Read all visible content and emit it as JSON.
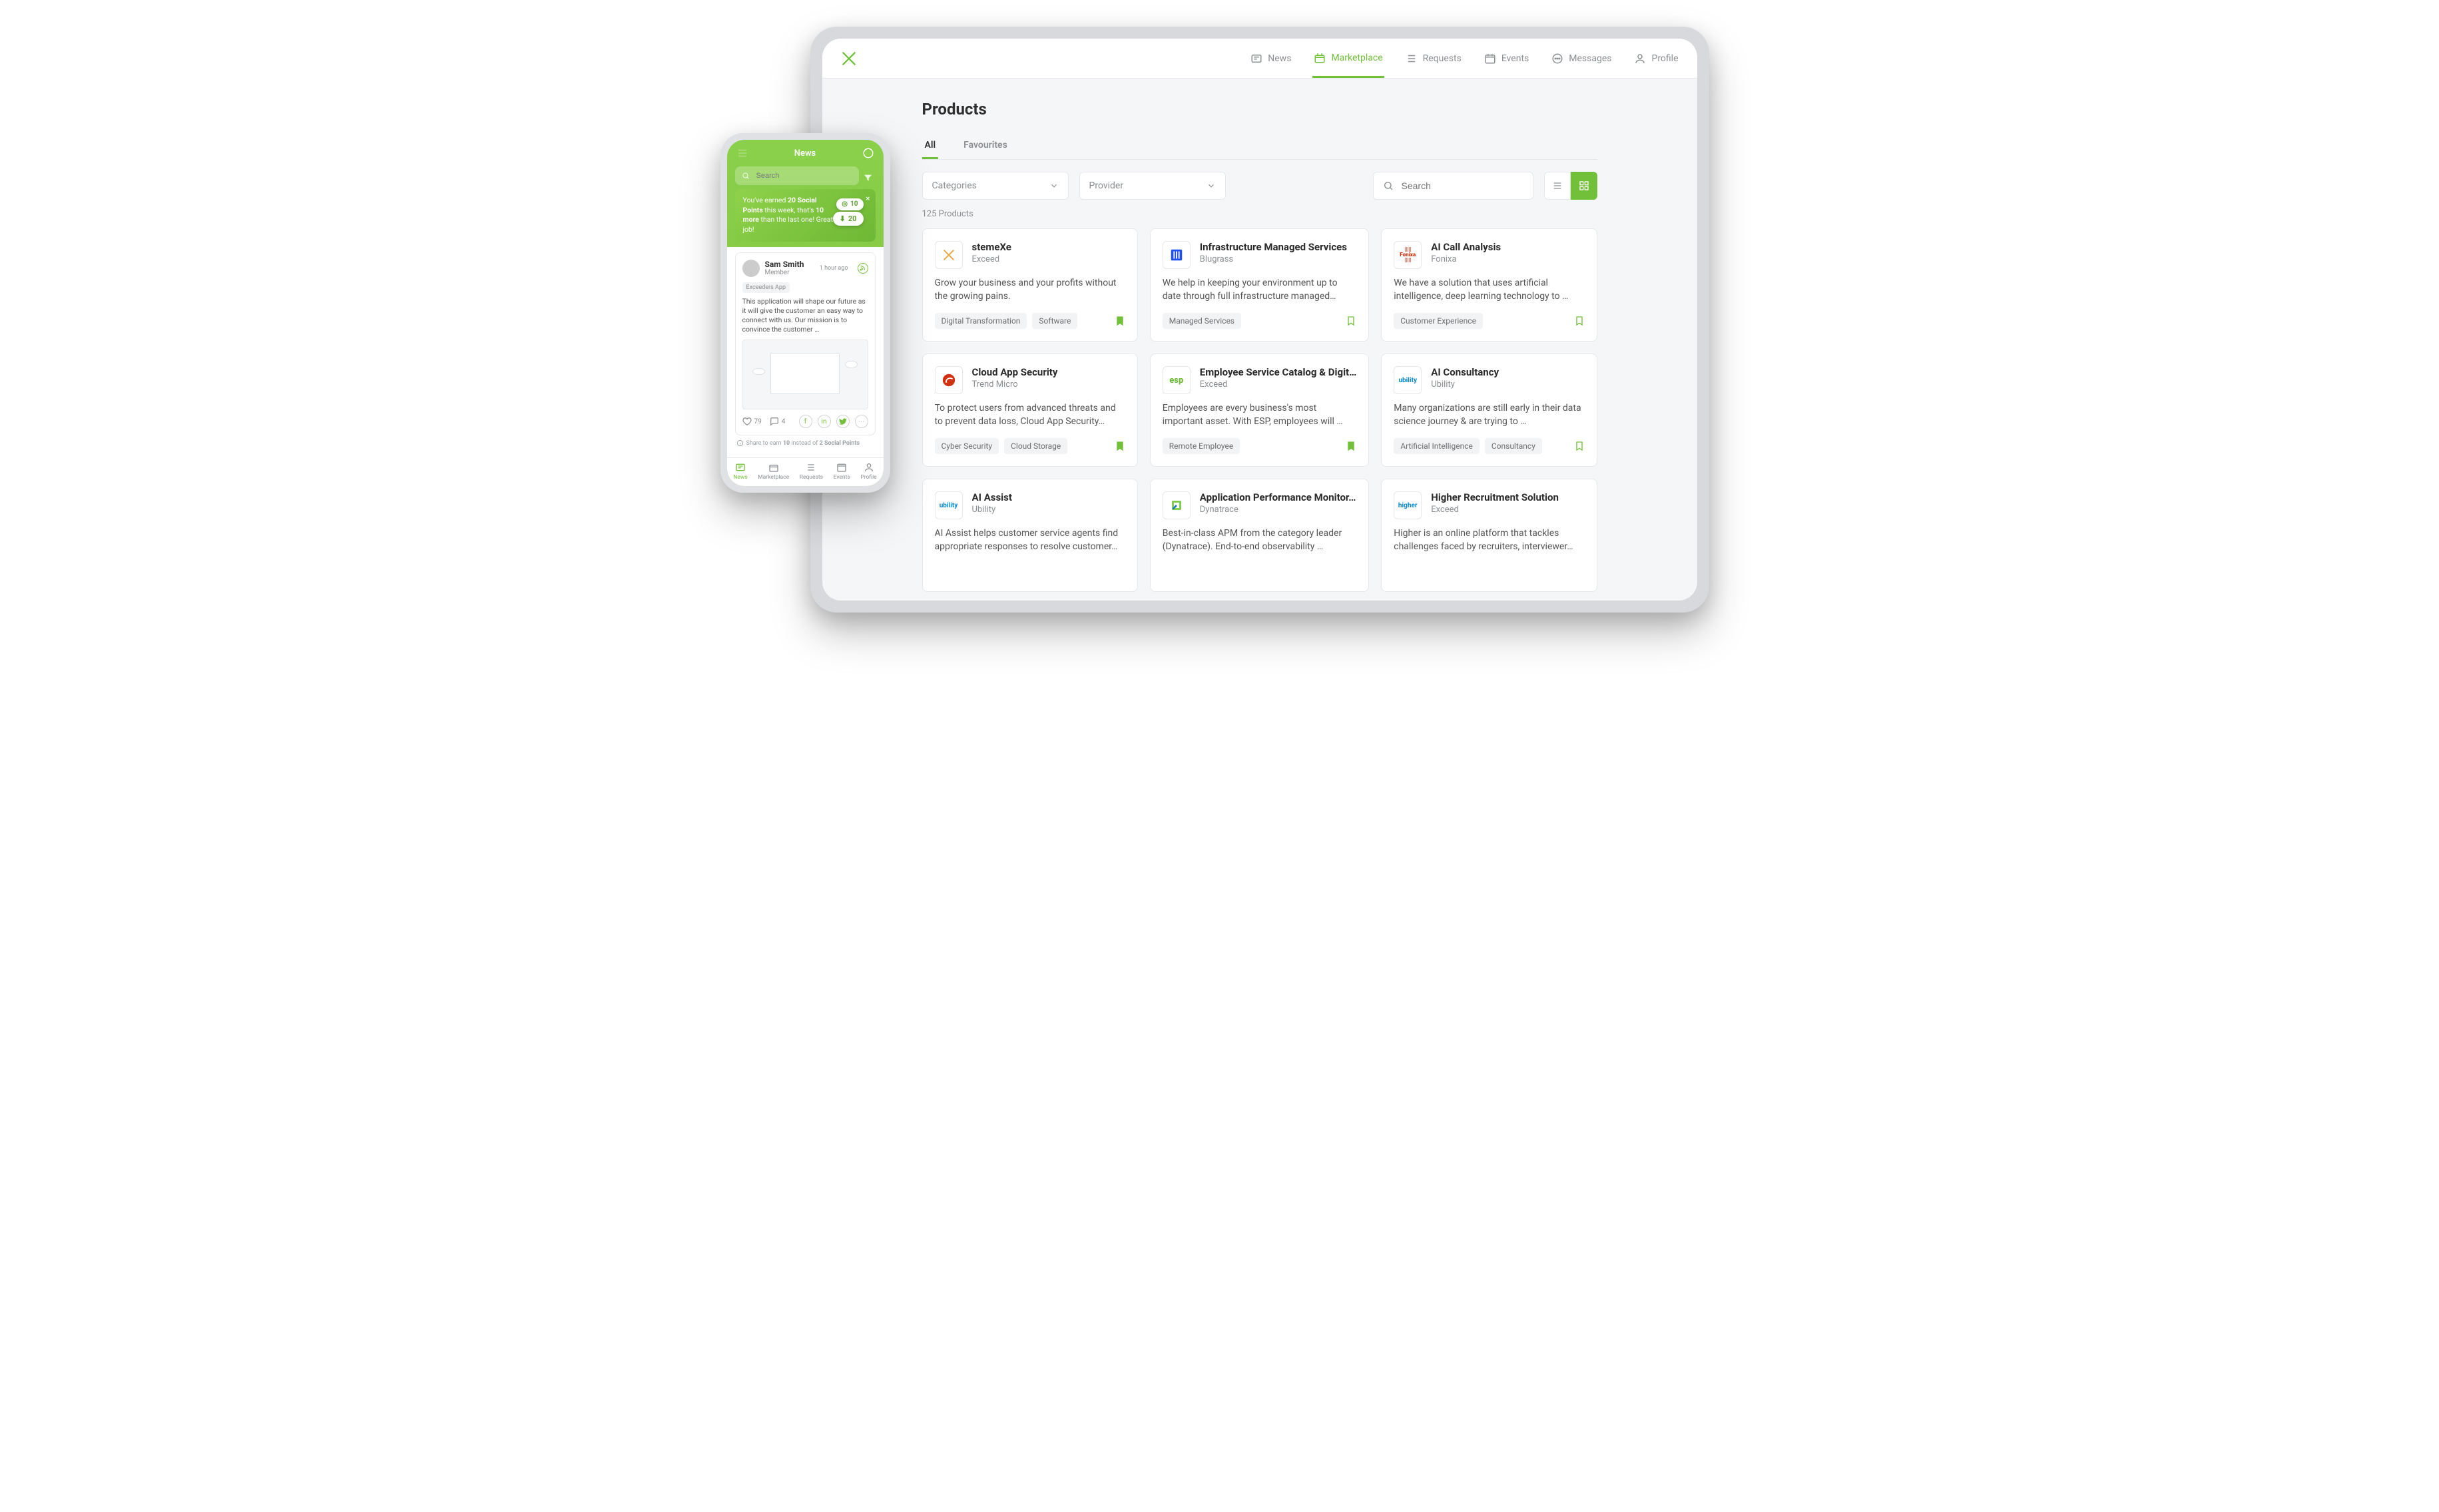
{
  "colors": {
    "accent": "#72bf3a"
  },
  "tablet": {
    "nav": {
      "items": [
        {
          "label": "News"
        },
        {
          "label": "Marketplace"
        },
        {
          "label": "Requests"
        },
        {
          "label": "Events"
        },
        {
          "label": "Messages"
        },
        {
          "label": "Profile"
        }
      ]
    },
    "page_title": "Products",
    "tabs": [
      {
        "label": "All",
        "active": true
      },
      {
        "label": "Favourites",
        "active": false
      }
    ],
    "filters": {
      "categories_label": "Categories",
      "provider_label": "Provider",
      "search_placeholder": "Search"
    },
    "count": "125 Products",
    "products": [
      {
        "name": "stemeXe",
        "provider": "Exceed",
        "desc": "Grow your business and your profits without the growing pains.",
        "tags": [
          "Digital Transformation",
          "Software"
        ],
        "bookmarked": true,
        "logo": "x"
      },
      {
        "name": "Infrastructure Managed Services",
        "provider": "Blugrass",
        "desc": "We help in keeping your environment up to date through full infrastructure managed…",
        "tags": [
          "Managed Services"
        ],
        "bookmarked": false,
        "logo": "blu"
      },
      {
        "name": "AI Call Analysis",
        "provider": "Fonixa",
        "desc": "We have a solution that uses artificial intelligence, deep learning technology to …",
        "tags": [
          "Customer Experience"
        ],
        "bookmarked": false,
        "logo": "fonixa"
      },
      {
        "name": "Cloud App Security",
        "provider": "Trend Micro",
        "desc": "To protect users from advanced threats and to prevent data loss, Cloud App Security…",
        "tags": [
          "Cyber Security",
          "Cloud Storage"
        ],
        "bookmarked": true,
        "logo": "trend"
      },
      {
        "name": "Employee Service Catalog & Digit…",
        "provider": "Exceed",
        "desc": "Employees are every business's most important asset. With ESP, employees will …",
        "tags": [
          "Remote Employee"
        ],
        "bookmarked": true,
        "logo": "esp"
      },
      {
        "name": "AI Consultancy",
        "provider": "Ubility",
        "desc": "Many organizations are still early in their data science journey & are trying to …",
        "tags": [
          "Artificial Intelligence",
          "Consultancy"
        ],
        "bookmarked": false,
        "logo": "ubility"
      },
      {
        "name": "AI Assist",
        "provider": "Ubility",
        "desc": "AI Assist helps customer service agents find appropriate responses to resolve customer…",
        "tags": [],
        "bookmarked": false,
        "logo": "ubility"
      },
      {
        "name": "Application Performance Monitor…",
        "provider": "Dynatrace",
        "desc": "Best-in-class APM from the category leader (Dynatrace). End-to-end observability …",
        "tags": [],
        "bookmarked": false,
        "logo": "dyna"
      },
      {
        "name": "Higher Recruitment Solution",
        "provider": "Exceed",
        "desc": "Higher is an online platform that tackles challenges faced by recruiters, interviewer…",
        "tags": [],
        "bookmarked": false,
        "logo": "higher"
      }
    ]
  },
  "phone": {
    "top_title": "News",
    "search_placeholder": "Search",
    "banner": {
      "line1_a": "You've earned ",
      "line1_b": "20 Social Points",
      "line2_a": " this week, that's ",
      "line2_b": "10 more",
      "line2_c": " than the last one! Great job!",
      "coin1": "10",
      "coin2": "20"
    },
    "post": {
      "user": "Sam Smith",
      "role": "Member",
      "time": "1 hour ago",
      "app_tag": "Exceeders App",
      "text": "This application will shape our future as it will give the customer an easy way to connect with us. Our mission is to convince the customer …",
      "likes": "79",
      "comments": "4",
      "share_hint_a": "Share to earn ",
      "share_hint_b": "10",
      "share_hint_c": " instead of ",
      "share_hint_d": "2 Social Points"
    },
    "tabs": [
      {
        "label": "News"
      },
      {
        "label": "Marketplace"
      },
      {
        "label": "Requests"
      },
      {
        "label": "Events"
      },
      {
        "label": "Profile"
      }
    ]
  }
}
